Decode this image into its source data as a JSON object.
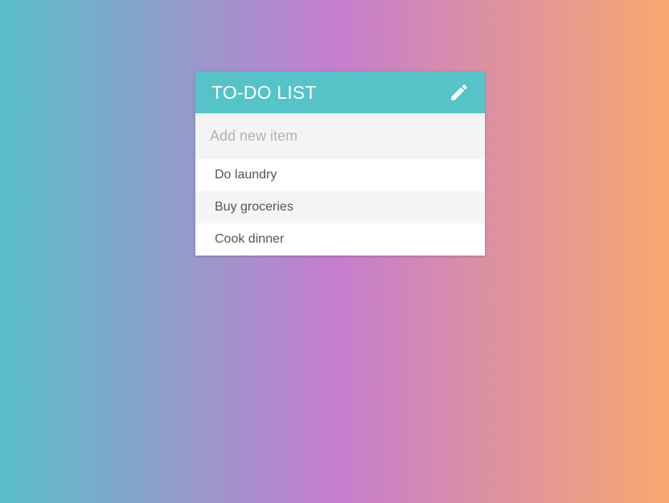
{
  "card": {
    "title": "TO-DO LIST",
    "edit_icon": "pencil-icon",
    "input": {
      "placeholder": "Add new item",
      "value": ""
    },
    "items": [
      {
        "label": "Do laundry"
      },
      {
        "label": "Buy groceries"
      },
      {
        "label": "Cook dinner"
      }
    ]
  },
  "colors": {
    "header": "#55c3c8",
    "gradient_left": "#59bfc9",
    "gradient_mid": "#c57dce",
    "gradient_right": "#f7a86f"
  }
}
